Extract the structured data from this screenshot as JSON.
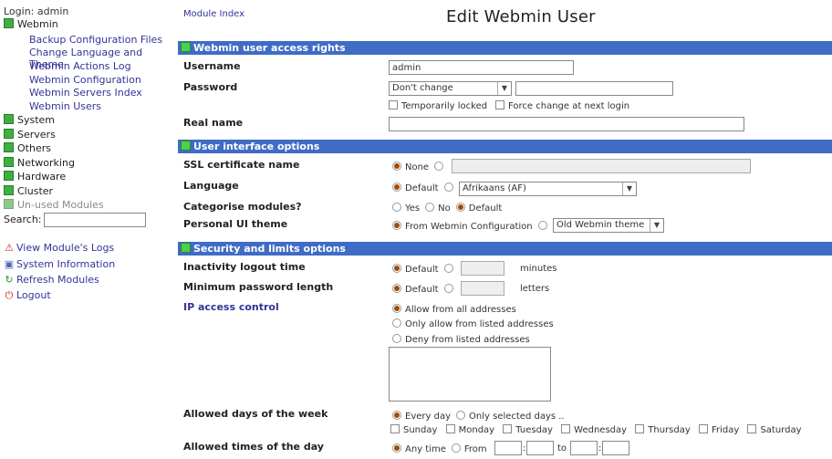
{
  "sidebar": {
    "login": "Login: admin",
    "categories": {
      "webmin": "Webmin",
      "system": "System",
      "servers": "Servers",
      "others": "Others",
      "networking": "Networking",
      "hardware": "Hardware",
      "cluster": "Cluster",
      "unused": "Un-used Modules"
    },
    "webmin_items": [
      "Backup Configuration Files",
      "Change Language and Theme",
      "Webmin Actions Log",
      "Webmin Configuration",
      "Webmin Servers Index",
      "Webmin Users"
    ],
    "search_label": "Search:",
    "actions": {
      "view_logs": "View Module's Logs",
      "system_info": "System Information",
      "refresh": "Refresh Modules",
      "logout": "Logout"
    }
  },
  "header": {
    "module_index": "Module Index",
    "title": "Edit Webmin User"
  },
  "sections": {
    "access_rights": "Webmin user access rights",
    "ui_options": "User interface options",
    "security": "Security and limits options"
  },
  "access": {
    "username_label": "Username",
    "username_value": "admin",
    "password_label": "Password",
    "password_option": "Don't change",
    "temp_locked": "Temporarily locked",
    "force_change": "Force change at next login",
    "real_name_label": "Real name"
  },
  "ui": {
    "ssl_label": "SSL certificate name",
    "ssl_none": "None",
    "language_label": "Language",
    "language_default": "Default",
    "language_value": "Afrikaans (AF)",
    "categorise_label": "Categorise modules?",
    "cat_yes": "Yes",
    "cat_no": "No",
    "cat_default": "Default",
    "theme_label": "Personal UI theme",
    "theme_from": "From Webmin Configuration",
    "theme_value": "Old Webmin theme"
  },
  "security": {
    "inactivity_label": "Inactivity logout time",
    "inactivity_default": "Default",
    "inactivity_unit": "minutes",
    "minpass_label": "Minimum password length",
    "minpass_default": "Default",
    "minpass_unit": "letters",
    "ip_label": "IP access control",
    "ip_all": "Allow from all addresses",
    "ip_only": "Only allow from listed addresses",
    "ip_deny": "Deny from listed addresses",
    "days_label": "Allowed days of the week",
    "days_every": "Every day",
    "days_selected": "Only selected days ..",
    "days": [
      "Sunday",
      "Monday",
      "Tuesday",
      "Wednesday",
      "Thursday",
      "Friday",
      "Saturday"
    ],
    "times_label": "Allowed times of the day",
    "times_any": "Any time",
    "times_from": "From",
    "times_to": "to"
  }
}
